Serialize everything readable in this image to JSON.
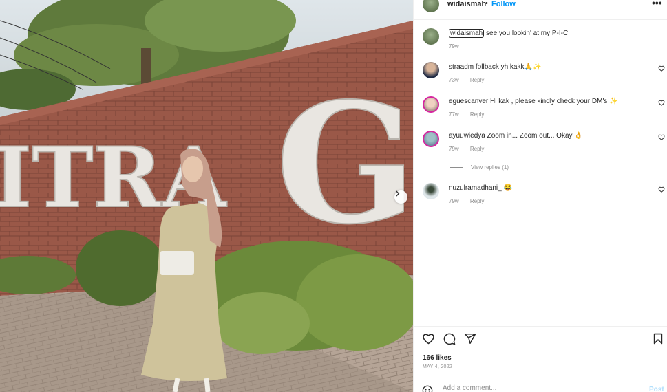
{
  "post": {
    "username": "widaismah",
    "follow_label": "Follow",
    "dot": "•",
    "more_label": "•••",
    "photo_sign_text": "ITRA G"
  },
  "caption": {
    "username": "widaismah",
    "text": "see you lookin' at my P-I-C",
    "time": "79w"
  },
  "comments": [
    {
      "username": "straadm",
      "text": "follback yh kakk🙏✨",
      "time": "73w",
      "reply_label": "Reply"
    },
    {
      "username": "eguescanver",
      "text": "Hi kak , please kindly check your DM's ✨",
      "time": "77w",
      "reply_label": "Reply"
    },
    {
      "username": "ayuuwiedya",
      "text": "Zoom in... Zoom out... Okay 👌",
      "time": "79w",
      "reply_label": "Reply"
    },
    {
      "username": "nuzulramadhani_",
      "text": "😂",
      "time": "79w",
      "reply_label": "Reply"
    }
  ],
  "view_replies_label": "View replies (1)",
  "likes": "166 likes",
  "date": "MAY 4, 2022",
  "add_comment": {
    "placeholder": "Add a comment...",
    "post_label": "Post"
  },
  "colors": {
    "accent": "#0095f6",
    "text": "#262626",
    "muted": "#8e8e8e",
    "post_disabled": "#b2dffc"
  },
  "icons": [
    "more-icon",
    "heart-icon",
    "comment-icon",
    "share-icon",
    "bookmark-icon",
    "emoji-icon",
    "chevron-right-icon"
  ]
}
